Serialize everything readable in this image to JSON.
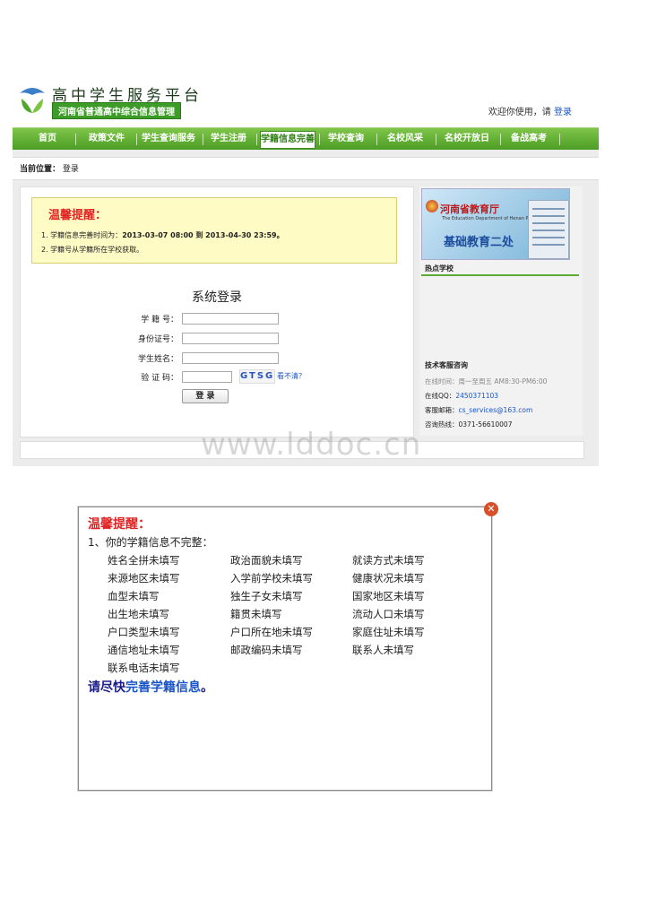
{
  "header": {
    "logo_title": "高中学生服务平台",
    "logo_subtitle": "河南省普通高中综合信息管理",
    "welcome_text": "欢迎你使用，请",
    "login_link": "登录"
  },
  "nav": {
    "items": [
      {
        "label": "首页"
      },
      {
        "label": "政策文件"
      },
      {
        "label": "学生查询服务"
      },
      {
        "label": "学生注册"
      },
      {
        "label": "学籍信息完善",
        "active": true
      },
      {
        "label": "学校查询"
      },
      {
        "label": "名校风采"
      },
      {
        "label": "名校开放日"
      },
      {
        "label": "备战高考"
      }
    ]
  },
  "breadcrumb": {
    "label": "当前位置：",
    "current": "登录"
  },
  "notice": {
    "title": "温馨提醒：",
    "line1_prefix": "1. 学籍信息完善时间为：",
    "line1_dates": "2013-03-07 08:00 到 2013-04-30 23:59。",
    "line2": "2. 学籍号从学籍所在学校获取。"
  },
  "login": {
    "title": "系统登录",
    "student_id_label": "学 籍 号：",
    "id_card_label": "身份证号：",
    "name_label": "学生姓名：",
    "captcha_label": "验 证 码：",
    "captcha_text": "GTSG",
    "captcha_refresh": "看不清？",
    "submit": "登 录"
  },
  "right_panel": {
    "banner_org": "河南省教育厅",
    "banner_en": "The Education Department of Henan Province",
    "banner_dept": "基础教育二处",
    "hot_schools_title": "热点学校",
    "tech_support_title": "技术客服咨询",
    "online_hours": "在线时间：周一至周五 AM8:30-PM6:00",
    "qq_label": "在线QQ：",
    "qq_value": "2450371103",
    "email_label": "客服邮箱：",
    "email_value": "cs_services@163.com",
    "hotline": "咨询热线：0371-56610007"
  },
  "watermark": "www.lddoc.cn",
  "popup": {
    "title": "温馨提醒：",
    "intro": "1、你的学籍信息不完整：",
    "items": [
      "姓名全拼未填写",
      "政治面貌未填写",
      "就读方式未填写",
      "来源地区未填写",
      "入学前学校未填写",
      "健康状况未填写",
      "血型未填写",
      "独生子女未填写",
      "国家地区未填写",
      "出生地未填写",
      "籍贯未填写",
      "流动人口未填写",
      "户口类型未填写",
      "户口所在地未填写",
      "家庭住址未填写",
      "通信地址未填写",
      "邮政编码未填写",
      "联系人未填写",
      "联系电话未填写"
    ],
    "footer_prefix": "请尽快",
    "footer_link": "完善学籍信息",
    "footer_suffix": "。"
  },
  "colors": {
    "nav_green": "#4c9d24",
    "notice_bg": "#fefbc4",
    "alert_red": "#e02424",
    "link_blue": "#1a55c8"
  }
}
